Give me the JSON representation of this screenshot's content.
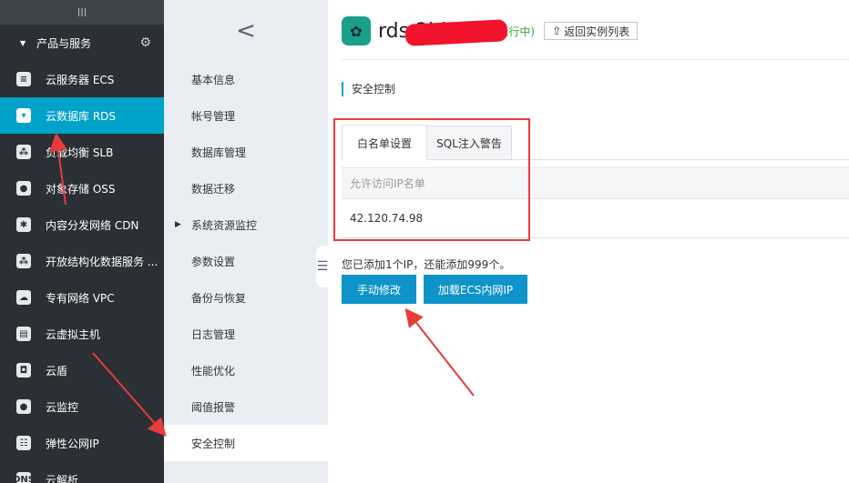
{
  "sidebar": {
    "top_glyph": "III",
    "section": {
      "label": "产品与服务",
      "caret_icon": "caret-down-icon",
      "gear_icon": "gear-icon"
    },
    "items": [
      {
        "label": "云服务器 ECS",
        "icon": "server-icon",
        "glyph": "≡"
      },
      {
        "label": "云数据库 RDS",
        "icon": "database-icon",
        "glyph": "▾"
      },
      {
        "label": "负载均衡 SLB",
        "icon": "load-balancer-icon",
        "glyph": "⁂"
      },
      {
        "label": "对象存储 OSS",
        "icon": "storage-icon",
        "glyph": "●"
      },
      {
        "label": "内容分发网络 CDN",
        "icon": "cdn-icon",
        "glyph": "✱"
      },
      {
        "label": "开放结构化数据服务 ...",
        "icon": "ots-icon",
        "glyph": "⁂"
      },
      {
        "label": "专有网络 VPC",
        "icon": "vpc-icon",
        "glyph": "☁"
      },
      {
        "label": "云虚拟主机",
        "icon": "host-icon",
        "glyph": "▤"
      },
      {
        "label": "云盾",
        "icon": "shield-icon",
        "glyph": "◘"
      },
      {
        "label": "云监控",
        "icon": "monitor-icon",
        "glyph": "●"
      },
      {
        "label": "弹性公网IP",
        "icon": "eip-icon",
        "glyph": "☷"
      },
      {
        "label": "云解析",
        "icon": "dns-icon",
        "glyph": "DNS"
      }
    ],
    "active_index": 1,
    "colors": {
      "background": "#2a3035",
      "active": "#00a2ca"
    }
  },
  "submenu": {
    "back_glyph": "<",
    "items": [
      {
        "label": "基本信息"
      },
      {
        "label": "帐号管理"
      },
      {
        "label": "数据库管理"
      },
      {
        "label": "数据迁移"
      },
      {
        "label": "系统资源监控",
        "expandable": true
      },
      {
        "label": "参数设置"
      },
      {
        "label": "备份与恢复"
      },
      {
        "label": "日志管理"
      },
      {
        "label": "性能优化"
      },
      {
        "label": "阈值报警"
      },
      {
        "label": "安全控制"
      }
    ],
    "active_index": 10,
    "fold_glyph": "☰"
  },
  "header": {
    "instance_name": "rds        2bkw...",
    "status": "(运行中)",
    "back_button": "返回实例列表",
    "back_glyph": "⇧"
  },
  "page": {
    "title": "安全控制"
  },
  "tabs": [
    {
      "label": "白名单设置",
      "active": true
    },
    {
      "label": "SQL注入警告",
      "active": false
    }
  ],
  "whitelist": {
    "column_header": "允许访问IP名单",
    "rows": [
      "42.120.74.98"
    ]
  },
  "hint": "您已添加1个IP，还能添加999个。",
  "buttons": {
    "edit": "手动修改",
    "load_ecs": "加载ECS内网IP"
  },
  "colors": {
    "accent": "#00a2ca",
    "button": "#0e94c9",
    "status": "#3ca940",
    "annotation": "#e83b3b"
  }
}
